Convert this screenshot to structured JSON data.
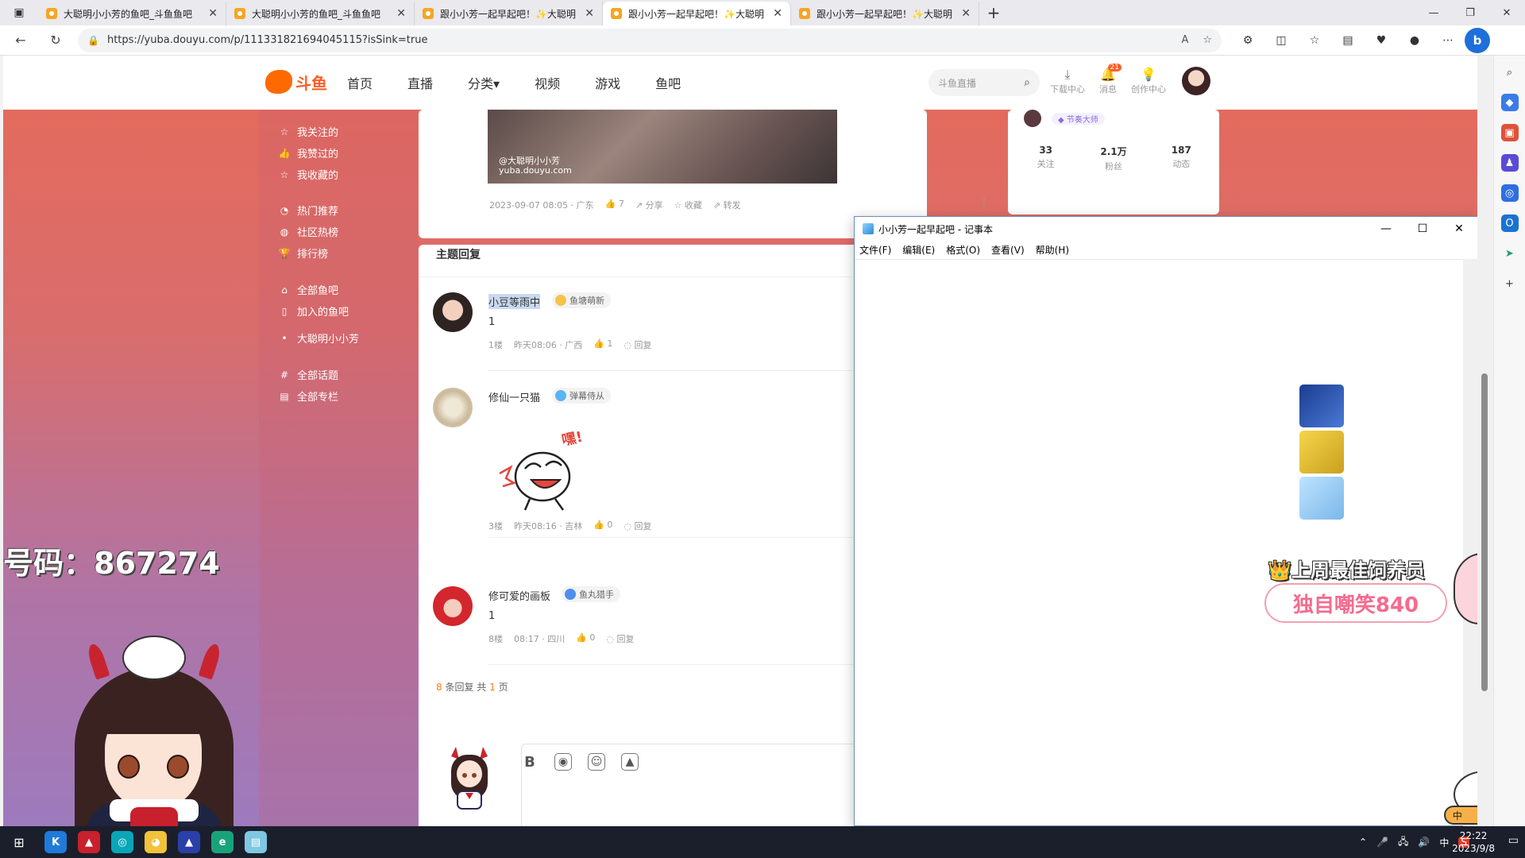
{
  "browser": {
    "tabs": [
      {
        "title": "大聪明小小芳的鱼吧_斗鱼鱼吧",
        "active": false
      },
      {
        "title": "大聪明小小芳的鱼吧_斗鱼鱼吧",
        "active": false
      },
      {
        "title": "跟小小芳一起早起吧！✨大聪明",
        "active": false
      },
      {
        "title": "跟小小芳一起早起吧！✨大聪明",
        "active": true
      },
      {
        "title": "跟小小芳一起早起吧！✨大聪明",
        "active": false
      }
    ],
    "url": "https://yuba.douyu.com/p/1113318216940451​15?isSink=true"
  },
  "site": {
    "logo_text": "斗鱼",
    "nav": [
      "首页",
      "直播",
      "分类▾",
      "视频",
      "游戏",
      "鱼吧"
    ],
    "search_placeholder": "斗鱼直播",
    "tools": [
      {
        "label": "下载中心",
        "icon": "download-icon"
      },
      {
        "label": "消息",
        "icon": "bell-icon",
        "badge": "21"
      },
      {
        "label": "创作中心",
        "icon": "lightbulb-icon"
      }
    ]
  },
  "leftnav": {
    "items": [
      {
        "label": "我关注的",
        "icon": "star-icon"
      },
      {
        "label": "我赞过的",
        "icon": "thumb-icon"
      },
      {
        "label": "我收藏的",
        "icon": "favorite-icon"
      },
      {
        "label": "热门推荐",
        "icon": "fire-icon"
      },
      {
        "label": "社区热榜",
        "icon": "chat-icon"
      },
      {
        "label": "排行榜",
        "icon": "trophy-icon"
      },
      {
        "label": "全部鱼吧",
        "icon": "home-icon"
      },
      {
        "label": "加入的鱼吧",
        "icon": "bookmark-icon"
      },
      {
        "label": "大聪明小小芳",
        "icon": "dot-icon"
      },
      {
        "label": "全部话题",
        "icon": "hash-icon"
      },
      {
        "label": "全部专栏",
        "icon": "column-icon"
      }
    ]
  },
  "post": {
    "watermark_line1": "@大聪明小小芳",
    "watermark_line2": "yuba.douyu.com",
    "date": "2023-09-07 08:05 · 广东",
    "likes": "7",
    "share": "分享",
    "favorite": "收藏",
    "forward": "转发"
  },
  "profile": {
    "tag": "节奏大师",
    "stats": [
      {
        "num": "33",
        "label": "关注"
      },
      {
        "num": "2.1万",
        "label": "粉丝"
      },
      {
        "num": "187",
        "label": "动态"
      }
    ]
  },
  "replies": {
    "title": "主题回复",
    "items": [
      {
        "name": "小豆等雨中",
        "badge": "鱼塘萌新",
        "content": "1",
        "floor": "1楼",
        "time": "昨天08:06 · 广西",
        "likes": "1",
        "reply": "回复"
      },
      {
        "name": "修仙一只猫",
        "badge": "弹幕侍从",
        "content": "",
        "floor": "3楼",
        "time": "昨天08:16 · 吉林",
        "likes": "0",
        "reply": "回复"
      },
      {
        "name": "修可爱的画板",
        "badge": "鱼丸猎手",
        "content": "1",
        "floor": "8楼",
        "time": "08:17 · 四川",
        "likes": "0",
        "reply": "回复"
      }
    ],
    "pager": {
      "count": "8",
      "text1": "条回复 共",
      "pages": "1",
      "text2": "页"
    }
  },
  "sticker_text": "嘿!",
  "overlay": {
    "number": "号码：867274",
    "weekly_title": "上周最佳饲养员",
    "weekly_name": "独自嘲笑840",
    "ime": [
      "中",
      "♪",
      "🎓"
    ]
  },
  "notepad": {
    "title": "小小芳一起早起吧 - 记事本",
    "menu": [
      "文件(F)",
      "编辑(E)",
      "格式(O)",
      "查看(V)",
      "帮助(H)"
    ]
  },
  "taskbar": {
    "time": "22:22",
    "date": "2023/9/8",
    "ime": "中"
  }
}
